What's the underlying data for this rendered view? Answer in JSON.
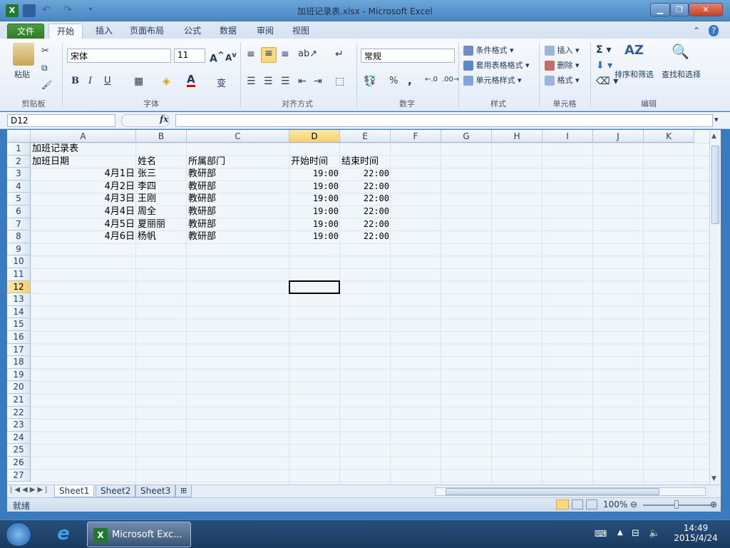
{
  "window": {
    "title": "加班记录表.xlsx - Microsoft Excel"
  },
  "tabs": [
    {
      "label": "文件"
    },
    {
      "label": "开始"
    },
    {
      "label": "插入"
    },
    {
      "label": "页面布局"
    },
    {
      "label": "公式"
    },
    {
      "label": "数据"
    },
    {
      "label": "审阅"
    },
    {
      "label": "视图"
    }
  ],
  "ribbon": {
    "clipboard": {
      "paste": "粘贴",
      "group": "剪贴板"
    },
    "font": {
      "name": "宋体",
      "size": "11",
      "group": "字体",
      "bold": "B",
      "italic": "I",
      "underline": "U"
    },
    "alignment": {
      "group": "对齐方式"
    },
    "number": {
      "format": "常规",
      "group": "数字",
      "percent": "%",
      "comma": ","
    },
    "styles": {
      "conditional": "条件格式",
      "table": "套用表格格式",
      "cell": "单元格样式",
      "group": "样式"
    },
    "cells": {
      "insert": "插入",
      "delete": "删除",
      "format": "格式",
      "group": "单元格"
    },
    "editing": {
      "sort": "排序和筛选",
      "find": "查找和选择",
      "group": "编辑"
    }
  },
  "formula_bar": {
    "name_box": "D12",
    "fx": "fx",
    "value": ""
  },
  "columns": [
    "A",
    "B",
    "C",
    "D",
    "E",
    "F",
    "G",
    "H",
    "I",
    "J",
    "K"
  ],
  "selected_column": "D",
  "selected_row": 12,
  "rows": [
    "1",
    "2",
    "3",
    "4",
    "5",
    "6",
    "7",
    "8",
    "9",
    "10",
    "11",
    "12",
    "13",
    "14",
    "15",
    "16",
    "17",
    "18",
    "19",
    "20",
    "21",
    "22",
    "23",
    "24",
    "25",
    "26",
    "27"
  ],
  "sheet": {
    "A1": "加班记录表",
    "A2": "加班日期",
    "B2": "姓名",
    "C2": "所属部门",
    "D2": "开始时间",
    "E2": "结束时间",
    "records": [
      {
        "date": "4月1日",
        "name": "张三",
        "dept": "教研部",
        "start": "19:00",
        "end": "22:00"
      },
      {
        "date": "4月2日",
        "name": "李四",
        "dept": "教研部",
        "start": "19:00",
        "end": "22:00"
      },
      {
        "date": "4月3日",
        "name": "王刚",
        "dept": "教研部",
        "start": "19:00",
        "end": "22:00"
      },
      {
        "date": "4月4日",
        "name": "周全",
        "dept": "教研部",
        "start": "19:00",
        "end": "22:00"
      },
      {
        "date": "4月5日",
        "name": "夏丽丽",
        "dept": "教研部",
        "start": "19:00",
        "end": "22:00"
      },
      {
        "date": "4月6日",
        "name": "杨帆",
        "dept": "教研部",
        "start": "19:00",
        "end": "22:00"
      }
    ]
  },
  "sheet_tabs": [
    "Sheet1",
    "Sheet2",
    "Sheet3"
  ],
  "status": {
    "ready": "就绪",
    "zoom": "100%"
  },
  "taskbar": {
    "app_button": "Microsoft Exc...",
    "time": "14:49",
    "date": "2015/4/24"
  }
}
